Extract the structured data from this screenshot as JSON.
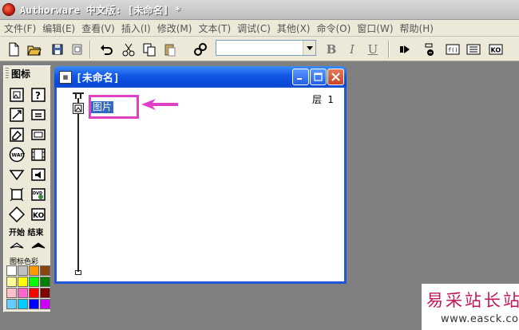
{
  "window": {
    "title": "Authorware 中文版: [未命名] *"
  },
  "menu": [
    "文件(F)",
    "编辑(E)",
    "查看(V)",
    "插入(I)",
    "修改(M)",
    "文本(T)",
    "调试(C)",
    "其他(X)",
    "命令(O)",
    "窗口(W)",
    "帮助(H)"
  ],
  "toolbar": {
    "bold": "B",
    "italic": "I",
    "underline": "U",
    "font_value": ""
  },
  "palette": {
    "title": "图标",
    "flag_start": "开始",
    "flag_end": "结束",
    "colors_label": "图标色彩",
    "icons": [
      "display-icon",
      "decision-icon",
      "motion-icon",
      "calculation-icon",
      "erase-icon",
      "map-icon",
      "wait-icon",
      "digital-movie-icon",
      "navigate-icon",
      "sound-icon",
      "framework-icon",
      "video-icon",
      "interaction-icon",
      "knowledge-object-icon"
    ],
    "swatches": [
      "#ffffff",
      "#c0c0c0",
      "#ff9900",
      "#8b4513",
      "#ffff99",
      "#ffff00",
      "#00ff00",
      "#008000",
      "#ffc0cb",
      "#ff66cc",
      "#ff0000",
      "#800000",
      "#66ccff",
      "#00ccff",
      "#0000ff",
      "#cc00ff"
    ]
  },
  "design_window": {
    "title": "[未命名]",
    "icon_label": "图片",
    "layer": "层 1"
  },
  "watermark": {
    "main": "易采站长站",
    "url": "www.easck.com"
  },
  "colors": {
    "highlight": "#e040c8",
    "selection": "#316ac5",
    "titlebar_blue": "#0a46d6"
  }
}
